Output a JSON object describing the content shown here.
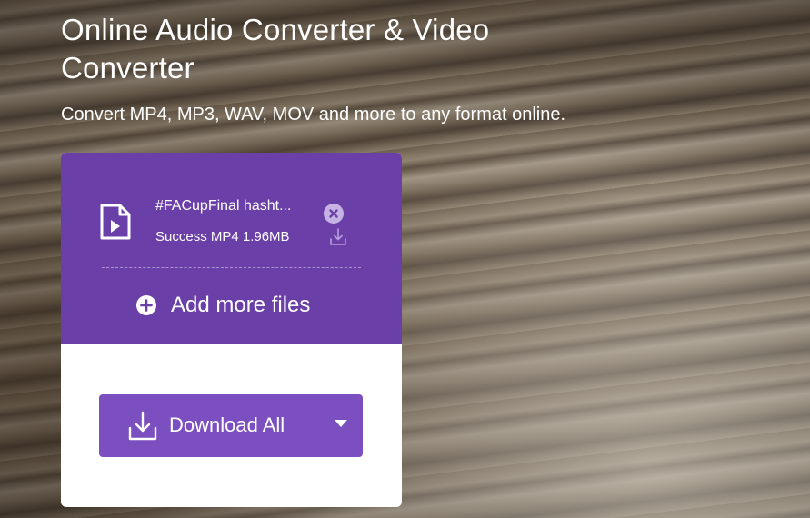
{
  "header": {
    "title": "Online Audio Converter & Video Converter",
    "subtitle": "Convert MP4, MP3, WAV, MOV and more to any format online."
  },
  "file": {
    "name": "#FACupFinal hasht...",
    "status": "Success MP4 1.96MB",
    "icon": "video-file-icon"
  },
  "actions": {
    "add_more_label": "Add more files",
    "download_all_label": "Download All"
  },
  "colors": {
    "card_purple": "#6a40a8",
    "button_purple": "#7b4fbf",
    "remove_badge": "#c6b3e3"
  }
}
